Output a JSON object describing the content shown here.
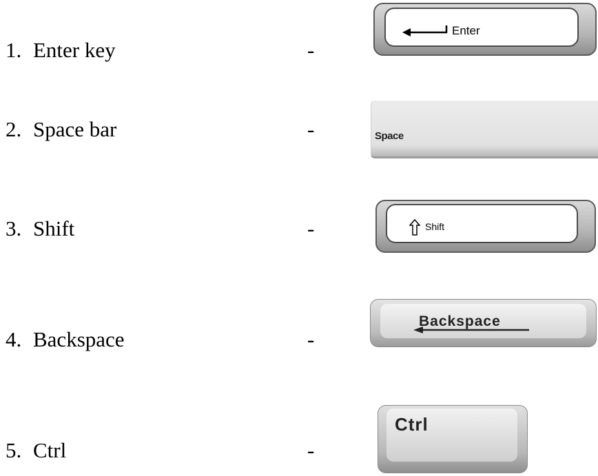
{
  "items": [
    {
      "number": "1.",
      "label": "Enter key",
      "dash": "-",
      "key_label": "Enter",
      "key_icon": "return-arrow-icon"
    },
    {
      "number": "2.",
      "label": "Space bar",
      "dash": "-",
      "key_label": "Space"
    },
    {
      "number": "3.",
      "label": "Shift",
      "dash": "-",
      "key_label": "Shift",
      "key_icon": "shift-arrow-icon"
    },
    {
      "number": "4.",
      "label": "Backspace",
      "dash": "-",
      "key_label": "Backspace",
      "key_icon": "left-arrow-icon"
    },
    {
      "number": "5.",
      "label": "Ctrl",
      "dash": "-",
      "key_label": "Ctrl"
    }
  ],
  "colors": {
    "text": "#000000",
    "key_bevel": "#b5b5b5",
    "key_face": "#ffffff"
  }
}
